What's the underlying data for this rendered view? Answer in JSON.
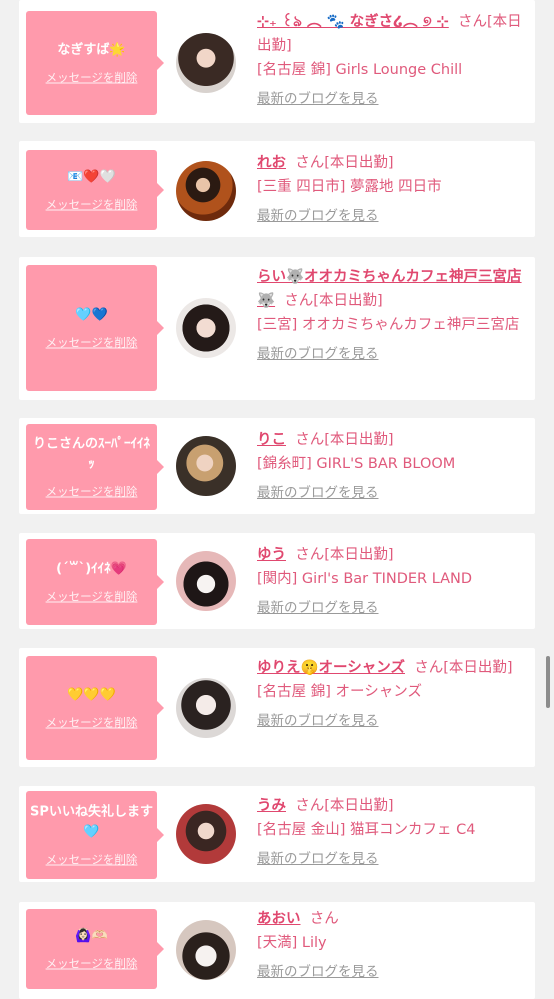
{
  "items": [
    {
      "message": "なぎすば🌟",
      "delete_label": "メッセージを削除",
      "name": "⊹₊ ꒰ঌ ︵ 🐾 なぎさ໒︵ ୭ ⊹",
      "san_label": "さん[本日出勤]",
      "shop": "[名古屋 錦] Girls Lounge Chill",
      "blog_label": "最新のブログを見る"
    },
    {
      "message": "📧❤️🤍",
      "delete_label": "メッセージを削除",
      "name": "れお",
      "san_label": "さん[本日出勤]",
      "shop": "[三重 四日市] 夢露地 四日市",
      "blog_label": "最新のブログを見る"
    },
    {
      "message": "🩵💙",
      "delete_label": "メッセージを削除",
      "name": "らい🐺オオカミちゃんカフェ神戸三宮店🐺",
      "san_label": "さん[本日出勤]",
      "shop": "[三宮] オオカミちゃんカフェ神戸三宮店",
      "blog_label": "最新のブログを見る"
    },
    {
      "message": "りこさんのｽｰﾊﾟｰｲｲﾈｯ",
      "delete_label": "メッセージを削除",
      "name": "りこ",
      "san_label": "さん[本日出勤]",
      "shop": "[錦糸町] GIRL'S BAR BLOOM",
      "blog_label": "最新のブログを見る"
    },
    {
      "message": "(ˊ꒳ˋ)ｲｲﾈ💗",
      "delete_label": "メッセージを削除",
      "name": "ゆう",
      "san_label": "さん[本日出勤]",
      "shop": "[関内] Girl's Bar TINDER LAND",
      "blog_label": "最新のブログを見る"
    },
    {
      "message": "💛💛💛",
      "delete_label": "メッセージを削除",
      "name": "ゆりえ🤫オーシャンズ",
      "san_label": "さん[本日出勤]",
      "shop": "[名古屋 錦] オーシャンズ",
      "blog_label": "最新のブログを見る"
    },
    {
      "message": "SPいいね失礼します🩵",
      "delete_label": "メッセージを削除",
      "name": "うみ",
      "san_label": "さん[本日出勤]",
      "shop": "[名古屋 金山] 猫耳コンカフェ C4",
      "blog_label": "最新のブログを見る"
    },
    {
      "message": "🙆🏻‍♀️🫶🏻",
      "delete_label": "メッセージを削除",
      "name": "あおい",
      "san_label": "さん",
      "shop": "[天満] Lily",
      "blog_label": "最新のブログを見る"
    }
  ],
  "colors": {
    "bubble": "#ff9aac",
    "name": "#e0486f",
    "text": "#e05a7c",
    "link_gray": "#9a9a9a",
    "background": "#f1f1f1"
  }
}
